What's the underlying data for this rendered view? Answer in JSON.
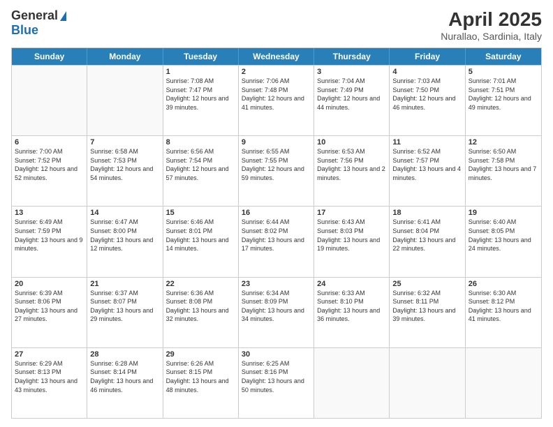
{
  "header": {
    "logo_general": "General",
    "logo_blue": "Blue",
    "month_title": "April 2025",
    "subtitle": "Nurallao, Sardinia, Italy"
  },
  "weekdays": [
    "Sunday",
    "Monday",
    "Tuesday",
    "Wednesday",
    "Thursday",
    "Friday",
    "Saturday"
  ],
  "rows": [
    [
      {
        "day": "",
        "sunrise": "",
        "sunset": "",
        "daylight": ""
      },
      {
        "day": "",
        "sunrise": "",
        "sunset": "",
        "daylight": ""
      },
      {
        "day": "1",
        "sunrise": "Sunrise: 7:08 AM",
        "sunset": "Sunset: 7:47 PM",
        "daylight": "Daylight: 12 hours and 39 minutes."
      },
      {
        "day": "2",
        "sunrise": "Sunrise: 7:06 AM",
        "sunset": "Sunset: 7:48 PM",
        "daylight": "Daylight: 12 hours and 41 minutes."
      },
      {
        "day": "3",
        "sunrise": "Sunrise: 7:04 AM",
        "sunset": "Sunset: 7:49 PM",
        "daylight": "Daylight: 12 hours and 44 minutes."
      },
      {
        "day": "4",
        "sunrise": "Sunrise: 7:03 AM",
        "sunset": "Sunset: 7:50 PM",
        "daylight": "Daylight: 12 hours and 46 minutes."
      },
      {
        "day": "5",
        "sunrise": "Sunrise: 7:01 AM",
        "sunset": "Sunset: 7:51 PM",
        "daylight": "Daylight: 12 hours and 49 minutes."
      }
    ],
    [
      {
        "day": "6",
        "sunrise": "Sunrise: 7:00 AM",
        "sunset": "Sunset: 7:52 PM",
        "daylight": "Daylight: 12 hours and 52 minutes."
      },
      {
        "day": "7",
        "sunrise": "Sunrise: 6:58 AM",
        "sunset": "Sunset: 7:53 PM",
        "daylight": "Daylight: 12 hours and 54 minutes."
      },
      {
        "day": "8",
        "sunrise": "Sunrise: 6:56 AM",
        "sunset": "Sunset: 7:54 PM",
        "daylight": "Daylight: 12 hours and 57 minutes."
      },
      {
        "day": "9",
        "sunrise": "Sunrise: 6:55 AM",
        "sunset": "Sunset: 7:55 PM",
        "daylight": "Daylight: 12 hours and 59 minutes."
      },
      {
        "day": "10",
        "sunrise": "Sunrise: 6:53 AM",
        "sunset": "Sunset: 7:56 PM",
        "daylight": "Daylight: 13 hours and 2 minutes."
      },
      {
        "day": "11",
        "sunrise": "Sunrise: 6:52 AM",
        "sunset": "Sunset: 7:57 PM",
        "daylight": "Daylight: 13 hours and 4 minutes."
      },
      {
        "day": "12",
        "sunrise": "Sunrise: 6:50 AM",
        "sunset": "Sunset: 7:58 PM",
        "daylight": "Daylight: 13 hours and 7 minutes."
      }
    ],
    [
      {
        "day": "13",
        "sunrise": "Sunrise: 6:49 AM",
        "sunset": "Sunset: 7:59 PM",
        "daylight": "Daylight: 13 hours and 9 minutes."
      },
      {
        "day": "14",
        "sunrise": "Sunrise: 6:47 AM",
        "sunset": "Sunset: 8:00 PM",
        "daylight": "Daylight: 13 hours and 12 minutes."
      },
      {
        "day": "15",
        "sunrise": "Sunrise: 6:46 AM",
        "sunset": "Sunset: 8:01 PM",
        "daylight": "Daylight: 13 hours and 14 minutes."
      },
      {
        "day": "16",
        "sunrise": "Sunrise: 6:44 AM",
        "sunset": "Sunset: 8:02 PM",
        "daylight": "Daylight: 13 hours and 17 minutes."
      },
      {
        "day": "17",
        "sunrise": "Sunrise: 6:43 AM",
        "sunset": "Sunset: 8:03 PM",
        "daylight": "Daylight: 13 hours and 19 minutes."
      },
      {
        "day": "18",
        "sunrise": "Sunrise: 6:41 AM",
        "sunset": "Sunset: 8:04 PM",
        "daylight": "Daylight: 13 hours and 22 minutes."
      },
      {
        "day": "19",
        "sunrise": "Sunrise: 6:40 AM",
        "sunset": "Sunset: 8:05 PM",
        "daylight": "Daylight: 13 hours and 24 minutes."
      }
    ],
    [
      {
        "day": "20",
        "sunrise": "Sunrise: 6:39 AM",
        "sunset": "Sunset: 8:06 PM",
        "daylight": "Daylight: 13 hours and 27 minutes."
      },
      {
        "day": "21",
        "sunrise": "Sunrise: 6:37 AM",
        "sunset": "Sunset: 8:07 PM",
        "daylight": "Daylight: 13 hours and 29 minutes."
      },
      {
        "day": "22",
        "sunrise": "Sunrise: 6:36 AM",
        "sunset": "Sunset: 8:08 PM",
        "daylight": "Daylight: 13 hours and 32 minutes."
      },
      {
        "day": "23",
        "sunrise": "Sunrise: 6:34 AM",
        "sunset": "Sunset: 8:09 PM",
        "daylight": "Daylight: 13 hours and 34 minutes."
      },
      {
        "day": "24",
        "sunrise": "Sunrise: 6:33 AM",
        "sunset": "Sunset: 8:10 PM",
        "daylight": "Daylight: 13 hours and 36 minutes."
      },
      {
        "day": "25",
        "sunrise": "Sunrise: 6:32 AM",
        "sunset": "Sunset: 8:11 PM",
        "daylight": "Daylight: 13 hours and 39 minutes."
      },
      {
        "day": "26",
        "sunrise": "Sunrise: 6:30 AM",
        "sunset": "Sunset: 8:12 PM",
        "daylight": "Daylight: 13 hours and 41 minutes."
      }
    ],
    [
      {
        "day": "27",
        "sunrise": "Sunrise: 6:29 AM",
        "sunset": "Sunset: 8:13 PM",
        "daylight": "Daylight: 13 hours and 43 minutes."
      },
      {
        "day": "28",
        "sunrise": "Sunrise: 6:28 AM",
        "sunset": "Sunset: 8:14 PM",
        "daylight": "Daylight: 13 hours and 46 minutes."
      },
      {
        "day": "29",
        "sunrise": "Sunrise: 6:26 AM",
        "sunset": "Sunset: 8:15 PM",
        "daylight": "Daylight: 13 hours and 48 minutes."
      },
      {
        "day": "30",
        "sunrise": "Sunrise: 6:25 AM",
        "sunset": "Sunset: 8:16 PM",
        "daylight": "Daylight: 13 hours and 50 minutes."
      },
      {
        "day": "",
        "sunrise": "",
        "sunset": "",
        "daylight": ""
      },
      {
        "day": "",
        "sunrise": "",
        "sunset": "",
        "daylight": ""
      },
      {
        "day": "",
        "sunrise": "",
        "sunset": "",
        "daylight": ""
      }
    ]
  ]
}
